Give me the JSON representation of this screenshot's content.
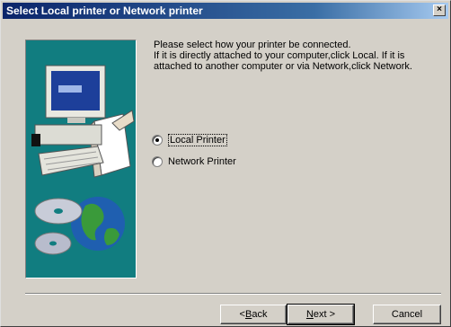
{
  "window": {
    "title": "Select Local printer or Network printer",
    "close_label": "×"
  },
  "message": {
    "line1": "Please select how your printer be connected.",
    "line2": "If it is directly attached to your computer,click Local. If it is",
    "line3": "attached to another computer or via Network,click Network."
  },
  "options": {
    "local_label": "Local Printer",
    "network_label": "Network Printer",
    "selected": "Local Printer"
  },
  "buttons": {
    "back_prefix": "< ",
    "back_mnemonic": "B",
    "back_rest": "ack",
    "next_mnemonic": "N",
    "next_rest": "ext >",
    "cancel_label": "Cancel"
  },
  "colors": {
    "title_gradient_start": "#0a246a",
    "art_background": "#117d80",
    "dialog_face": "#d4d0c8"
  }
}
